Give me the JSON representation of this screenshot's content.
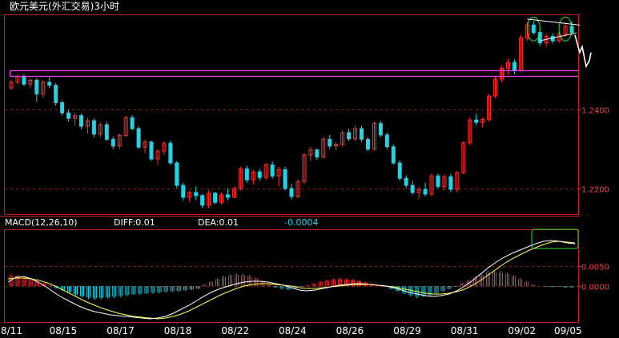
{
  "title": "欧元美元(外汇交易)3小时",
  "macd_header": {
    "name": "MACD(12,26,10)",
    "diff": "DIFF:0.01",
    "dea": "DEA:0.01",
    "value": "-0.0004"
  },
  "colors": {
    "background": "#000000",
    "up_candle": "#ff3030",
    "down_candle": "#22d3e6",
    "frame": "#c81e1e",
    "grid": "#a01818",
    "axis_text": "#ff4040",
    "diff_line": "#ffffff",
    "dea_line": "#ffff40",
    "resistance_band": "#ff40ff",
    "highlight": "#30e030"
  },
  "chart_data": [
    {
      "type": "candlestick",
      "ylim": [
        1.2135,
        1.264
      ],
      "y_ticks": [
        {
          "value": 1.24,
          "label": "1.2400"
        },
        {
          "value": 1.22,
          "label": "1.2200"
        }
      ],
      "x_ticks": [
        "8/11",
        "08/15",
        "08/17",
        "08/18",
        "08/22",
        "08/24",
        "08/26",
        "08/29",
        "08/31",
        "09/02",
        "09/05"
      ],
      "grid": true,
      "resistance_band": [
        1.2485,
        1.25
      ],
      "ohlc": [
        [
          1.2455,
          1.2475,
          1.245,
          1.247
        ],
        [
          1.247,
          1.249,
          1.2465,
          1.2485
        ],
        [
          1.2485,
          1.249,
          1.246,
          1.2465
        ],
        [
          1.2465,
          1.248,
          1.2455,
          1.2475
        ],
        [
          1.2475,
          1.248,
          1.242,
          1.244
        ],
        [
          1.244,
          1.2475,
          1.243,
          1.247
        ],
        [
          1.247,
          1.2482,
          1.2455,
          1.2462
        ],
        [
          1.2462,
          1.2468,
          1.241,
          1.2418
        ],
        [
          1.2418,
          1.2425,
          1.2385,
          1.2392
        ],
        [
          1.2392,
          1.24,
          1.237,
          1.2378
        ],
        [
          1.2378,
          1.2392,
          1.236,
          1.2385
        ],
        [
          1.2385,
          1.239,
          1.235,
          1.2358
        ],
        [
          1.2358,
          1.238,
          1.234,
          1.2372
        ],
        [
          1.2372,
          1.2378,
          1.233,
          1.2338
        ],
        [
          1.2338,
          1.2368,
          1.233,
          1.2362
        ],
        [
          1.2362,
          1.237,
          1.232,
          1.2325
        ],
        [
          1.2325,
          1.2332,
          1.23,
          1.2308
        ],
        [
          1.2308,
          1.234,
          1.23,
          1.2335
        ],
        [
          1.2335,
          1.2385,
          1.233,
          1.238
        ],
        [
          1.238,
          1.2386,
          1.2348,
          1.2352
        ],
        [
          1.2352,
          1.2358,
          1.23,
          1.2305
        ],
        [
          1.2305,
          1.2325,
          1.229,
          1.2318
        ],
        [
          1.2318,
          1.2322,
          1.227,
          1.2275
        ],
        [
          1.2275,
          1.23,
          1.226,
          1.2295
        ],
        [
          1.2295,
          1.232,
          1.2285,
          1.2315
        ],
        [
          1.2315,
          1.2322,
          1.226,
          1.2265
        ],
        [
          1.2265,
          1.227,
          1.22,
          1.2208
        ],
        [
          1.2208,
          1.2215,
          1.217,
          1.2178
        ],
        [
          1.2178,
          1.2195,
          1.2165,
          1.219
        ],
        [
          1.219,
          1.2205,
          1.217,
          1.2182
        ],
        [
          1.2182,
          1.2186,
          1.215,
          1.2158
        ],
        [
          1.2158,
          1.2195,
          1.215,
          1.2188
        ],
        [
          1.2188,
          1.2192,
          1.216,
          1.2165
        ],
        [
          1.2165,
          1.219,
          1.216,
          1.2184
        ],
        [
          1.2184,
          1.22,
          1.217,
          1.2178
        ],
        [
          1.2178,
          1.2205,
          1.2175,
          1.22
        ],
        [
          1.22,
          1.2255,
          1.2195,
          1.225
        ],
        [
          1.225,
          1.2258,
          1.2215,
          1.2222
        ],
        [
          1.2222,
          1.2248,
          1.221,
          1.2242
        ],
        [
          1.2242,
          1.225,
          1.222,
          1.2228
        ],
        [
          1.2228,
          1.2265,
          1.2222,
          1.226
        ],
        [
          1.226,
          1.2268,
          1.2225,
          1.2232
        ],
        [
          1.2232,
          1.2255,
          1.2205,
          1.2248
        ],
        [
          1.2248,
          1.2255,
          1.2195,
          1.22
        ],
        [
          1.22,
          1.2212,
          1.2172,
          1.218
        ],
        [
          1.218,
          1.2222,
          1.2175,
          1.2218
        ],
        [
          1.2218,
          1.229,
          1.2212,
          1.2285
        ],
        [
          1.2285,
          1.2305,
          1.227,
          1.2298
        ],
        [
          1.2298,
          1.2302,
          1.2272,
          1.228
        ],
        [
          1.228,
          1.233,
          1.2276,
          1.2325
        ],
        [
          1.2325,
          1.2336,
          1.23,
          1.2308
        ],
        [
          1.2308,
          1.2318,
          1.2296,
          1.2312
        ],
        [
          1.2312,
          1.2348,
          1.2306,
          1.2342
        ],
        [
          1.2342,
          1.2352,
          1.232,
          1.2326
        ],
        [
          1.2326,
          1.236,
          1.232,
          1.2352
        ],
        [
          1.2352,
          1.236,
          1.2318,
          1.2325
        ],
        [
          1.2325,
          1.233,
          1.2295,
          1.23
        ],
        [
          1.23,
          1.237,
          1.2296,
          1.2365
        ],
        [
          1.2365,
          1.2372,
          1.233,
          1.2336
        ],
        [
          1.2336,
          1.2342,
          1.23,
          1.2306
        ],
        [
          1.2306,
          1.2312,
          1.226,
          1.2265
        ],
        [
          1.2265,
          1.2272,
          1.222,
          1.2226
        ],
        [
          1.2226,
          1.2234,
          1.22,
          1.2208
        ],
        [
          1.2208,
          1.222,
          1.2185,
          1.219
        ],
        [
          1.219,
          1.2205,
          1.2172,
          1.2198
        ],
        [
          1.2198,
          1.2215,
          1.218,
          1.2186
        ],
        [
          1.2186,
          1.2238,
          1.218,
          1.2232
        ],
        [
          1.2232,
          1.2238,
          1.22,
          1.2205
        ],
        [
          1.2205,
          1.2236,
          1.2195,
          1.223
        ],
        [
          1.223,
          1.2238,
          1.219,
          1.2198
        ],
        [
          1.2198,
          1.2245,
          1.219,
          1.224
        ],
        [
          1.224,
          1.232,
          1.2236,
          1.2316
        ],
        [
          1.2316,
          1.238,
          1.231,
          1.2374
        ],
        [
          1.2374,
          1.239,
          1.236,
          1.2368
        ],
        [
          1.2368,
          1.238,
          1.2355,
          1.2375
        ],
        [
          1.2375,
          1.244,
          1.237,
          1.2435
        ],
        [
          1.2435,
          1.2485,
          1.243,
          1.2478
        ],
        [
          1.2478,
          1.2512,
          1.247,
          1.2505
        ],
        [
          1.2505,
          1.253,
          1.249,
          1.252
        ],
        [
          1.252,
          1.2528,
          1.249,
          1.25
        ],
        [
          1.25,
          1.259,
          1.2495,
          1.2582
        ],
        [
          1.2582,
          1.2622,
          1.2575,
          1.2615
        ],
        [
          1.2615,
          1.2625,
          1.259,
          1.2596
        ],
        [
          1.2596,
          1.2604,
          1.2562,
          1.257
        ],
        [
          1.257,
          1.2592,
          1.256,
          1.2586
        ],
        [
          1.2586,
          1.2594,
          1.2568,
          1.2575
        ],
        [
          1.2575,
          1.2598,
          1.257,
          1.2592
        ],
        [
          1.2592,
          1.262,
          1.2585,
          1.2612
        ],
        [
          1.2612,
          1.2625,
          1.259,
          1.2596
        ]
      ]
    },
    {
      "type": "macd",
      "ylim": [
        -0.009,
        0.014
      ],
      "y_ticks": [
        {
          "value": 0.005,
          "label": "0.0050"
        },
        {
          "value": 0.0,
          "label": "0.0000"
        }
      ],
      "grid": true,
      "histogram": [
        0.003,
        0.0028,
        0.0024,
        0.002,
        0.0014,
        0.0008,
        0.0002,
        -0.0006,
        -0.0012,
        -0.0018,
        -0.0024,
        -0.0028,
        -0.0032,
        -0.0034,
        -0.0033,
        -0.0032,
        -0.003,
        -0.0028,
        -0.0025,
        -0.0023,
        -0.0022,
        -0.002,
        -0.0019,
        -0.0018,
        -0.0016,
        -0.0015,
        -0.0014,
        -0.0012,
        -0.001,
        -0.0007,
        0.0004,
        0.0012,
        0.002,
        0.0026,
        0.003,
        0.0032,
        0.0031,
        0.0028,
        0.0022,
        0.0014,
        0.0006,
        -0.0004,
        -0.0008,
        -0.001,
        -0.0006,
        -0.0002,
        0.0003,
        0.0007,
        0.0012,
        0.0016,
        0.0019,
        0.002,
        0.0019,
        0.0017,
        0.0014,
        0.001,
        0.0006,
        0.0002,
        -0.0002,
        -0.0008,
        -0.0014,
        -0.002,
        -0.0026,
        -0.003,
        -0.0028,
        -0.0025,
        -0.002,
        -0.0014,
        -0.0008,
        -0.0002,
        0.0008,
        0.0016,
        0.0024,
        0.0032,
        0.0038,
        0.004,
        0.0038,
        0.0034,
        0.0028,
        0.002,
        0.0012,
        0.0004,
        0.0,
        -0.0002,
        -0.0003,
        -0.0002,
        -0.0004,
        -0.0004
      ],
      "diff": [
        0.001,
        0.0022,
        0.0024,
        0.0018,
        0.0008,
        -0.0004,
        -0.0018,
        -0.003,
        -0.004,
        -0.005,
        -0.0058,
        -0.0064,
        -0.0068,
        -0.0072,
        -0.0074,
        -0.0076,
        -0.0078,
        -0.008,
        -0.0082,
        -0.008,
        -0.0076,
        -0.0068,
        -0.0058,
        -0.0048,
        -0.0036,
        -0.0024,
        -0.0014,
        -0.0006,
        0.0,
        0.0006,
        0.001,
        0.0012,
        0.0012,
        0.001,
        0.0006,
        0.0002,
        -0.0004,
        -0.001,
        -0.0012,
        -0.001,
        -0.0006,
        -0.0002,
        0.0002,
        0.0004,
        0.0006,
        0.0006,
        0.0004,
        0.0002,
        0.0,
        -0.0004,
        -0.001,
        -0.0016,
        -0.002,
        -0.0024,
        -0.0026,
        -0.0024,
        -0.002,
        -0.0012,
        0.0,
        0.0014,
        0.003,
        0.0046,
        0.006,
        0.0072,
        0.0082,
        0.009,
        0.0098,
        0.0106,
        0.0112,
        0.0114,
        0.0112,
        0.0108,
        0.0106
      ],
      "dea": [
        0.0018,
        0.002,
        0.002,
        0.0018,
        0.0014,
        0.0008,
        0.0,
        -0.001,
        -0.002,
        -0.003,
        -0.004,
        -0.0048,
        -0.0056,
        -0.0062,
        -0.0068,
        -0.0072,
        -0.0076,
        -0.0078,
        -0.008,
        -0.0082,
        -0.008,
        -0.0076,
        -0.007,
        -0.0062,
        -0.0052,
        -0.0042,
        -0.0032,
        -0.0022,
        -0.0014,
        -0.0006,
        0.0,
        0.0004,
        0.0006,
        0.0006,
        0.0004,
        0.0002,
        0.0,
        -0.0004,
        -0.0006,
        -0.0006,
        -0.0004,
        -0.0002,
        0.0,
        0.0002,
        0.0004,
        0.0004,
        0.0004,
        0.0002,
        0.0,
        -0.0002,
        -0.0006,
        -0.001,
        -0.0014,
        -0.0018,
        -0.002,
        -0.002,
        -0.0018,
        -0.0014,
        -0.0008,
        0.0002,
        0.0014,
        0.0028,
        0.0042,
        0.0056,
        0.0068,
        0.0078,
        0.0088,
        0.0096,
        0.0104,
        0.011,
        0.0112,
        0.011,
        0.0108
      ]
    }
  ]
}
